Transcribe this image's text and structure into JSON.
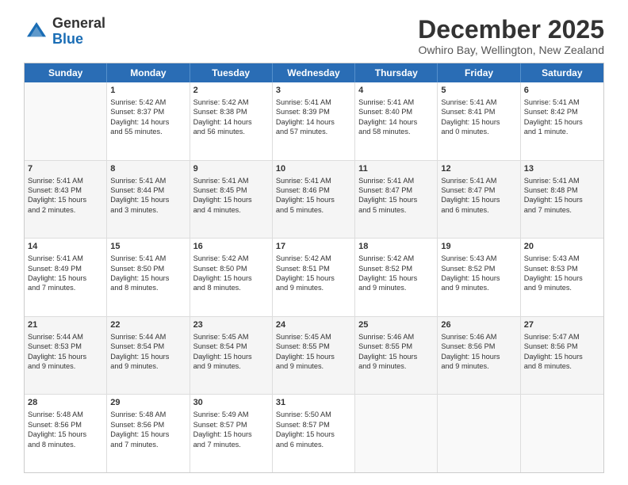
{
  "logo": {
    "line1": "General",
    "line2": "Blue"
  },
  "title": "December 2025",
  "subtitle": "Owhiro Bay, Wellington, New Zealand",
  "days": [
    "Sunday",
    "Monday",
    "Tuesday",
    "Wednesday",
    "Thursday",
    "Friday",
    "Saturday"
  ],
  "weeks": [
    [
      {
        "num": "",
        "info": ""
      },
      {
        "num": "1",
        "info": "Sunrise: 5:42 AM\nSunset: 8:37 PM\nDaylight: 14 hours\nand 55 minutes."
      },
      {
        "num": "2",
        "info": "Sunrise: 5:42 AM\nSunset: 8:38 PM\nDaylight: 14 hours\nand 56 minutes."
      },
      {
        "num": "3",
        "info": "Sunrise: 5:41 AM\nSunset: 8:39 PM\nDaylight: 14 hours\nand 57 minutes."
      },
      {
        "num": "4",
        "info": "Sunrise: 5:41 AM\nSunset: 8:40 PM\nDaylight: 14 hours\nand 58 minutes."
      },
      {
        "num": "5",
        "info": "Sunrise: 5:41 AM\nSunset: 8:41 PM\nDaylight: 15 hours\nand 0 minutes."
      },
      {
        "num": "6",
        "info": "Sunrise: 5:41 AM\nSunset: 8:42 PM\nDaylight: 15 hours\nand 1 minute."
      }
    ],
    [
      {
        "num": "7",
        "info": "Sunrise: 5:41 AM\nSunset: 8:43 PM\nDaylight: 15 hours\nand 2 minutes."
      },
      {
        "num": "8",
        "info": "Sunrise: 5:41 AM\nSunset: 8:44 PM\nDaylight: 15 hours\nand 3 minutes."
      },
      {
        "num": "9",
        "info": "Sunrise: 5:41 AM\nSunset: 8:45 PM\nDaylight: 15 hours\nand 4 minutes."
      },
      {
        "num": "10",
        "info": "Sunrise: 5:41 AM\nSunset: 8:46 PM\nDaylight: 15 hours\nand 5 minutes."
      },
      {
        "num": "11",
        "info": "Sunrise: 5:41 AM\nSunset: 8:47 PM\nDaylight: 15 hours\nand 5 minutes."
      },
      {
        "num": "12",
        "info": "Sunrise: 5:41 AM\nSunset: 8:47 PM\nDaylight: 15 hours\nand 6 minutes."
      },
      {
        "num": "13",
        "info": "Sunrise: 5:41 AM\nSunset: 8:48 PM\nDaylight: 15 hours\nand 7 minutes."
      }
    ],
    [
      {
        "num": "14",
        "info": "Sunrise: 5:41 AM\nSunset: 8:49 PM\nDaylight: 15 hours\nand 7 minutes."
      },
      {
        "num": "15",
        "info": "Sunrise: 5:41 AM\nSunset: 8:50 PM\nDaylight: 15 hours\nand 8 minutes."
      },
      {
        "num": "16",
        "info": "Sunrise: 5:42 AM\nSunset: 8:50 PM\nDaylight: 15 hours\nand 8 minutes."
      },
      {
        "num": "17",
        "info": "Sunrise: 5:42 AM\nSunset: 8:51 PM\nDaylight: 15 hours\nand 9 minutes."
      },
      {
        "num": "18",
        "info": "Sunrise: 5:42 AM\nSunset: 8:52 PM\nDaylight: 15 hours\nand 9 minutes."
      },
      {
        "num": "19",
        "info": "Sunrise: 5:43 AM\nSunset: 8:52 PM\nDaylight: 15 hours\nand 9 minutes."
      },
      {
        "num": "20",
        "info": "Sunrise: 5:43 AM\nSunset: 8:53 PM\nDaylight: 15 hours\nand 9 minutes."
      }
    ],
    [
      {
        "num": "21",
        "info": "Sunrise: 5:44 AM\nSunset: 8:53 PM\nDaylight: 15 hours\nand 9 minutes."
      },
      {
        "num": "22",
        "info": "Sunrise: 5:44 AM\nSunset: 8:54 PM\nDaylight: 15 hours\nand 9 minutes."
      },
      {
        "num": "23",
        "info": "Sunrise: 5:45 AM\nSunset: 8:54 PM\nDaylight: 15 hours\nand 9 minutes."
      },
      {
        "num": "24",
        "info": "Sunrise: 5:45 AM\nSunset: 8:55 PM\nDaylight: 15 hours\nand 9 minutes."
      },
      {
        "num": "25",
        "info": "Sunrise: 5:46 AM\nSunset: 8:55 PM\nDaylight: 15 hours\nand 9 minutes."
      },
      {
        "num": "26",
        "info": "Sunrise: 5:46 AM\nSunset: 8:56 PM\nDaylight: 15 hours\nand 9 minutes."
      },
      {
        "num": "27",
        "info": "Sunrise: 5:47 AM\nSunset: 8:56 PM\nDaylight: 15 hours\nand 8 minutes."
      }
    ],
    [
      {
        "num": "28",
        "info": "Sunrise: 5:48 AM\nSunset: 8:56 PM\nDaylight: 15 hours\nand 8 minutes."
      },
      {
        "num": "29",
        "info": "Sunrise: 5:48 AM\nSunset: 8:56 PM\nDaylight: 15 hours\nand 7 minutes."
      },
      {
        "num": "30",
        "info": "Sunrise: 5:49 AM\nSunset: 8:57 PM\nDaylight: 15 hours\nand 7 minutes."
      },
      {
        "num": "31",
        "info": "Sunrise: 5:50 AM\nSunset: 8:57 PM\nDaylight: 15 hours\nand 6 minutes."
      },
      {
        "num": "",
        "info": ""
      },
      {
        "num": "",
        "info": ""
      },
      {
        "num": "",
        "info": ""
      }
    ]
  ]
}
